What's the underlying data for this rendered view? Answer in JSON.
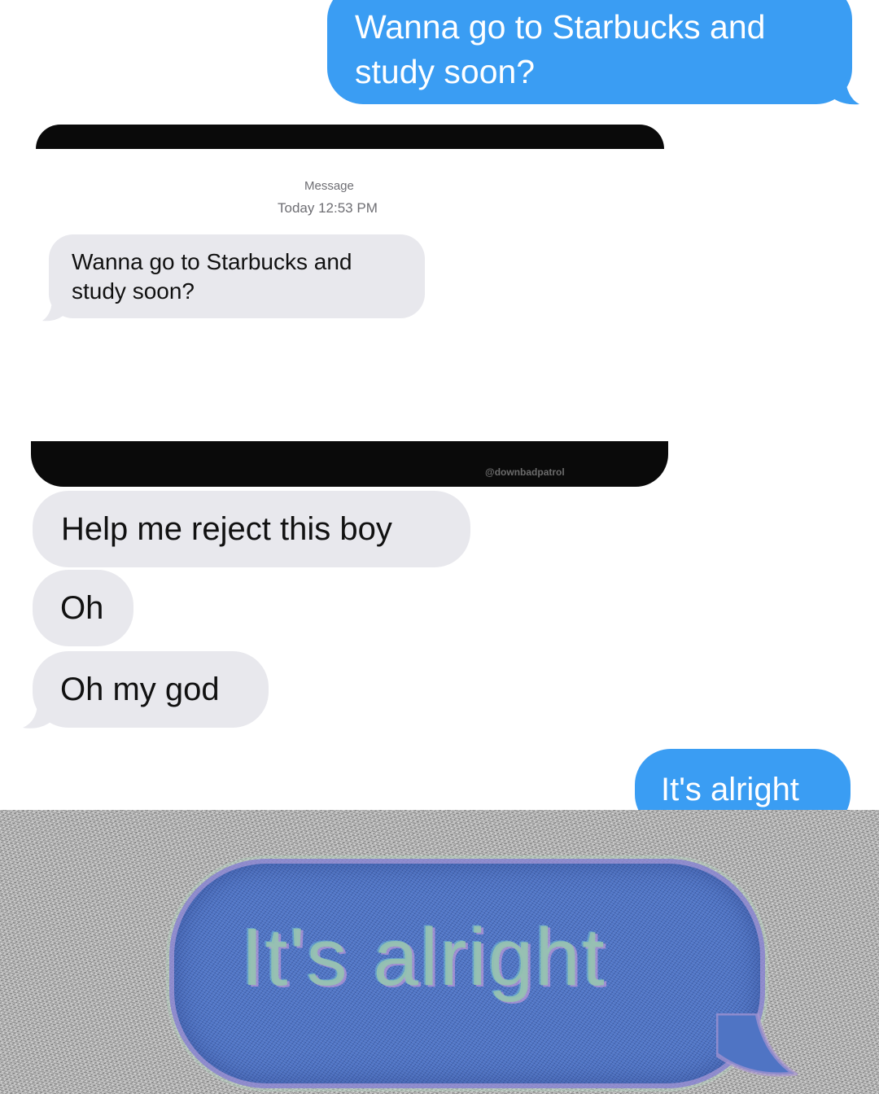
{
  "conversation": {
    "top_sent_message": "Wanna go to Starbucks and study soon?",
    "notification": {
      "label": "Message",
      "time": "Today 12:53 PM",
      "text": "Wanna go to Starbucks and study soon?"
    },
    "watermark": "@downbadpatrol",
    "received_messages": [
      "Help me reject this boy",
      "Oh",
      "Oh my god"
    ],
    "reply": "It's alright"
  },
  "zoom_panel": {
    "text": "It's alright"
  },
  "colors": {
    "sent_bubble": "#3a9df3",
    "received_bubble": "#e8e8ed",
    "strip": "#0a0a0a",
    "zoom_bubble": "#4f74c4"
  }
}
